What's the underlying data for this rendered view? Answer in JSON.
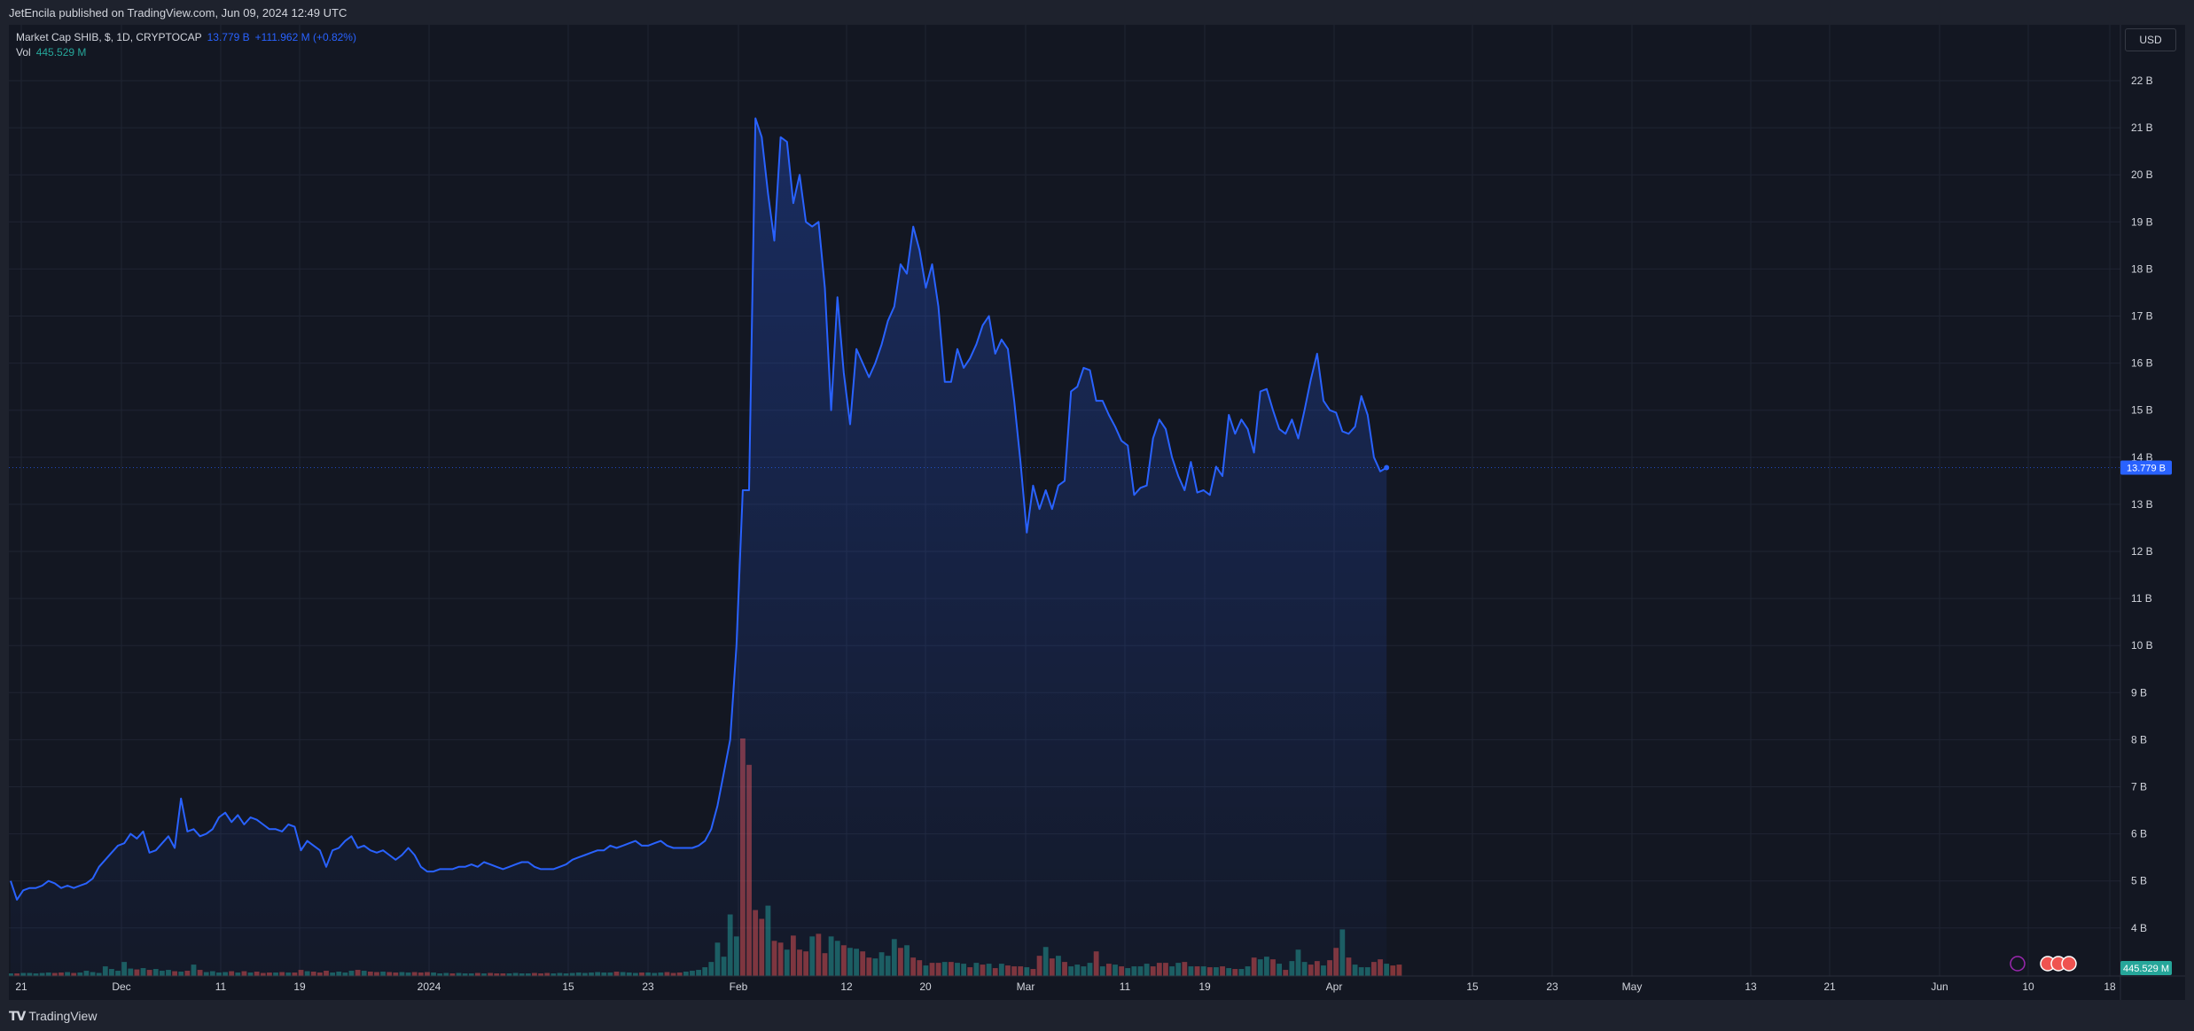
{
  "header": {
    "publish_text": "JetEncila published on TradingView.com, Jun 09, 2024 12:49 UTC"
  },
  "legend": {
    "symbol": "Market Cap SHIB, $, 1D, CRYPTOCAP",
    "last": "13.779 B",
    "change": "+111.962 M (+0.82%)",
    "vol_label": "Vol",
    "vol_value": "445.529 M"
  },
  "currency_button": "USD",
  "footer": {
    "brand": "TradingView"
  },
  "colors": {
    "background": "#131722",
    "line": "#2962ff",
    "volume_up": "#26a69a",
    "volume_down": "#ef5350",
    "grid": "#1f2432",
    "text": "#d1d4dc"
  },
  "chart_data": {
    "type": "area",
    "y_unit": "B USD",
    "ylim": [
      3.5,
      22.8
    ],
    "y_ticks": [
      "22 B",
      "21 B",
      "20 B",
      "19 B",
      "18 B",
      "17 B",
      "16 B",
      "15 B",
      "14 B",
      "13 B",
      "12 B",
      "11 B",
      "10 B",
      "9 B",
      "8 B",
      "7 B",
      "6 B",
      "5 B",
      "4 B"
    ],
    "x_ticks": [
      "21",
      "Dec",
      "11",
      "19",
      "2024",
      "15",
      "23",
      "Feb",
      "12",
      "20",
      "Mar",
      "11",
      "19",
      "Apr",
      "15",
      "23",
      "May",
      "13",
      "21",
      "Jun",
      "10",
      "18"
    ],
    "last_price_label": "13.779 B",
    "last_volume_label": "445.529 M",
    "market_cap": [
      5.0,
      4.6,
      4.8,
      4.85,
      4.85,
      4.9,
      5.0,
      4.95,
      4.85,
      4.9,
      4.85,
      4.9,
      4.95,
      5.05,
      5.3,
      5.45,
      5.6,
      5.75,
      5.8,
      6.0,
      5.9,
      6.05,
      5.6,
      5.65,
      5.8,
      5.95,
      5.7,
      6.75,
      6.05,
      6.1,
      5.95,
      6.0,
      6.1,
      6.35,
      6.45,
      6.25,
      6.4,
      6.2,
      6.35,
      6.3,
      6.2,
      6.1,
      6.1,
      6.05,
      6.2,
      6.15,
      5.65,
      5.85,
      5.75,
      5.65,
      5.3,
      5.65,
      5.7,
      5.85,
      5.95,
      5.7,
      5.75,
      5.65,
      5.6,
      5.65,
      5.55,
      5.45,
      5.55,
      5.7,
      5.55,
      5.3,
      5.2,
      5.2,
      5.25,
      5.25,
      5.25,
      5.3,
      5.3,
      5.35,
      5.3,
      5.4,
      5.35,
      5.3,
      5.25,
      5.3,
      5.35,
      5.4,
      5.4,
      5.3,
      5.25,
      5.25,
      5.25,
      5.3,
      5.35,
      5.45,
      5.5,
      5.55,
      5.6,
      5.65,
      5.65,
      5.75,
      5.7,
      5.75,
      5.8,
      5.85,
      5.75,
      5.75,
      5.8,
      5.85,
      5.75,
      5.7,
      5.7,
      5.7,
      5.7,
      5.75,
      5.85,
      6.1,
      6.6,
      7.3,
      8.0,
      10.0,
      13.3,
      13.3,
      21.2,
      20.8,
      19.6,
      18.6,
      20.8,
      20.7,
      19.4,
      20.0,
      19.0,
      18.9,
      19.0,
      17.6,
      15.0,
      17.4,
      15.8,
      14.7,
      16.3,
      16.0,
      15.7,
      16.0,
      16.4,
      16.9,
      17.2,
      18.1,
      17.9,
      18.9,
      18.4,
      17.6,
      18.1,
      17.2,
      15.6,
      15.6,
      16.3,
      15.9,
      16.1,
      16.4,
      16.8,
      17.0,
      16.2,
      16.5,
      16.3,
      15.2,
      13.9,
      12.4,
      13.4,
      12.9,
      13.3,
      12.9,
      13.4,
      13.5,
      15.4,
      15.5,
      15.9,
      15.85,
      15.2,
      15.2,
      14.9,
      14.65,
      14.35,
      14.25,
      13.2,
      13.35,
      13.4,
      14.4,
      14.8,
      14.6,
      14.0,
      13.6,
      13.3,
      13.9,
      13.25,
      13.3,
      13.2,
      13.8,
      13.6,
      14.9,
      14.5,
      14.8,
      14.6,
      14.1,
      15.4,
      15.45,
      15.0,
      14.6,
      14.5,
      14.8,
      14.4,
      15.0,
      15.65,
      16.2,
      15.2,
      15.0,
      14.95,
      14.55,
      14.5,
      14.65,
      15.3,
      14.9,
      14.0,
      13.7,
      13.78
    ],
    "volume_m": [
      30,
      30,
      35,
      35,
      30,
      35,
      40,
      35,
      40,
      45,
      35,
      40,
      60,
      45,
      35,
      110,
      80,
      60,
      160,
      85,
      75,
      90,
      70,
      80,
      60,
      70,
      55,
      50,
      60,
      130,
      70,
      45,
      55,
      40,
      45,
      55,
      40,
      55,
      40,
      50,
      35,
      40,
      40,
      45,
      40,
      40,
      70,
      55,
      50,
      40,
      60,
      40,
      50,
      40,
      60,
      70,
      60,
      50,
      45,
      50,
      45,
      40,
      45,
      40,
      45,
      40,
      45,
      40,
      30,
      35,
      30,
      35,
      30,
      30,
      35,
      30,
      35,
      30,
      30,
      30,
      35,
      30,
      30,
      35,
      30,
      35,
      30,
      35,
      30,
      35,
      40,
      35,
      40,
      45,
      40,
      40,
      50,
      45,
      40,
      35,
      40,
      40,
      35,
      40,
      45,
      35,
      40,
      50,
      60,
      70,
      100,
      160,
      380,
      220,
      700,
      450,
      2700,
      2400,
      750,
      650,
      800,
      400,
      380,
      300,
      460,
      300,
      280,
      450,
      480,
      260,
      450,
      400,
      350,
      320,
      310,
      280,
      210,
      200,
      270,
      230,
      420,
      320,
      350,
      210,
      180,
      120,
      150,
      150,
      160,
      160,
      150,
      140,
      100,
      150,
      130,
      140,
      90,
      140,
      120,
      110,
      110,
      100,
      80,
      230,
      330,
      200,
      230,
      160,
      110,
      130,
      110,
      150,
      280,
      110,
      140,
      130,
      110,
      90,
      110,
      110,
      140,
      110,
      150,
      150,
      110,
      150,
      160,
      110,
      110,
      110,
      100,
      100,
      110,
      90,
      80,
      80,
      110,
      210,
      190,
      220,
      190,
      140,
      70,
      170,
      300,
      160,
      130,
      170,
      120,
      180,
      320,
      530,
      210,
      130,
      100,
      100,
      160,
      190,
      140,
      120,
      130
    ],
    "volume_up": [
      1,
      0,
      1,
      1,
      1,
      1,
      1,
      0,
      0,
      1,
      0,
      1,
      1,
      1,
      1,
      1,
      1,
      1,
      1,
      1,
      0,
      1,
      0,
      1,
      1,
      1,
      0,
      1,
      0,
      1,
      0,
      1,
      1,
      1,
      1,
      0,
      1,
      0,
      1,
      0,
      0,
      0,
      1,
      0,
      1,
      0,
      0,
      1,
      0,
      0,
      0,
      1,
      1,
      1,
      1,
      0,
      1,
      0,
      0,
      1,
      0,
      0,
      1,
      1,
      0,
      0,
      0,
      1,
      1,
      1,
      0,
      1,
      1,
      1,
      0,
      1,
      0,
      0,
      0,
      1,
      1,
      1,
      1,
      0,
      0,
      0,
      1,
      1,
      1,
      1,
      1,
      1,
      1,
      1,
      1,
      1,
      0,
      1,
      1,
      1,
      0,
      1,
      1,
      1,
      0,
      0,
      0,
      1,
      1,
      1,
      1,
      1,
      1,
      1,
      1,
      1,
      0,
      0,
      0,
      0,
      1,
      0,
      0,
      1,
      0,
      0,
      0,
      1,
      0,
      0,
      1,
      1,
      0,
      1,
      1,
      0,
      0,
      1,
      1,
      1,
      1,
      0,
      1,
      0,
      0,
      1,
      0,
      0,
      1,
      0,
      1,
      1,
      0,
      1,
      0,
      1,
      0,
      1,
      0,
      0,
      0,
      1,
      0,
      0,
      1,
      0,
      1,
      0,
      1,
      1,
      1,
      1,
      0,
      1,
      0,
      1,
      0,
      1,
      1,
      1,
      1,
      0,
      0,
      0,
      1,
      1,
      0,
      1,
      0,
      1,
      0,
      1,
      0,
      1,
      0,
      1,
      1,
      0,
      1,
      1,
      0,
      1,
      0,
      1,
      1,
      1,
      0,
      0,
      1,
      0,
      0,
      1,
      0,
      1,
      1,
      1,
      0,
      0,
      1
    ]
  }
}
